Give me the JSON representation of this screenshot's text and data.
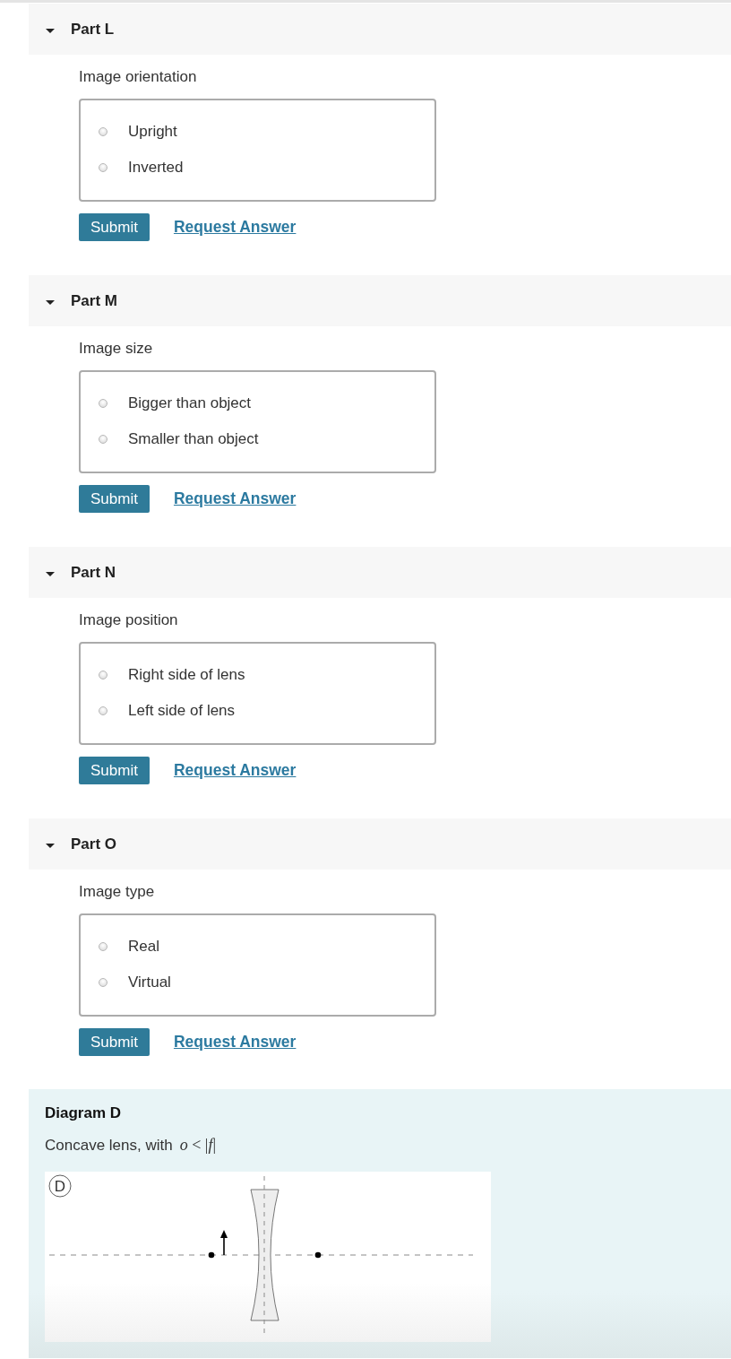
{
  "parts": [
    {
      "title": "Part L",
      "expanded": true,
      "question": "Image orientation",
      "options": [
        {
          "label": "Upright",
          "selected": false
        },
        {
          "label": "Inverted",
          "selected": false
        }
      ],
      "submit": "Submit",
      "request": "Request Answer"
    },
    {
      "title": "Part M",
      "expanded": true,
      "question": "Image size",
      "options": [
        {
          "label": "Bigger than object",
          "selected": false
        },
        {
          "label": "Smaller than object",
          "selected": false
        }
      ],
      "submit": "Submit",
      "request": "Request Answer"
    },
    {
      "title": "Part N",
      "expanded": true,
      "question": "Image position",
      "options": [
        {
          "label": "Right side of lens",
          "selected": false
        },
        {
          "label": "Left side of lens",
          "selected": false
        }
      ],
      "submit": "Submit",
      "request": "Request Answer"
    },
    {
      "title": "Part O",
      "expanded": true,
      "question": "Image type",
      "options": [
        {
          "label": "Real",
          "selected": false
        },
        {
          "label": "Virtual",
          "selected": false
        }
      ],
      "submit": "Submit",
      "request": "Request Answer"
    }
  ],
  "diagram": {
    "title": "Diagram D",
    "caption": "Concave lens, with",
    "formula": "*o* < |*f*|",
    "tag": "D"
  }
}
